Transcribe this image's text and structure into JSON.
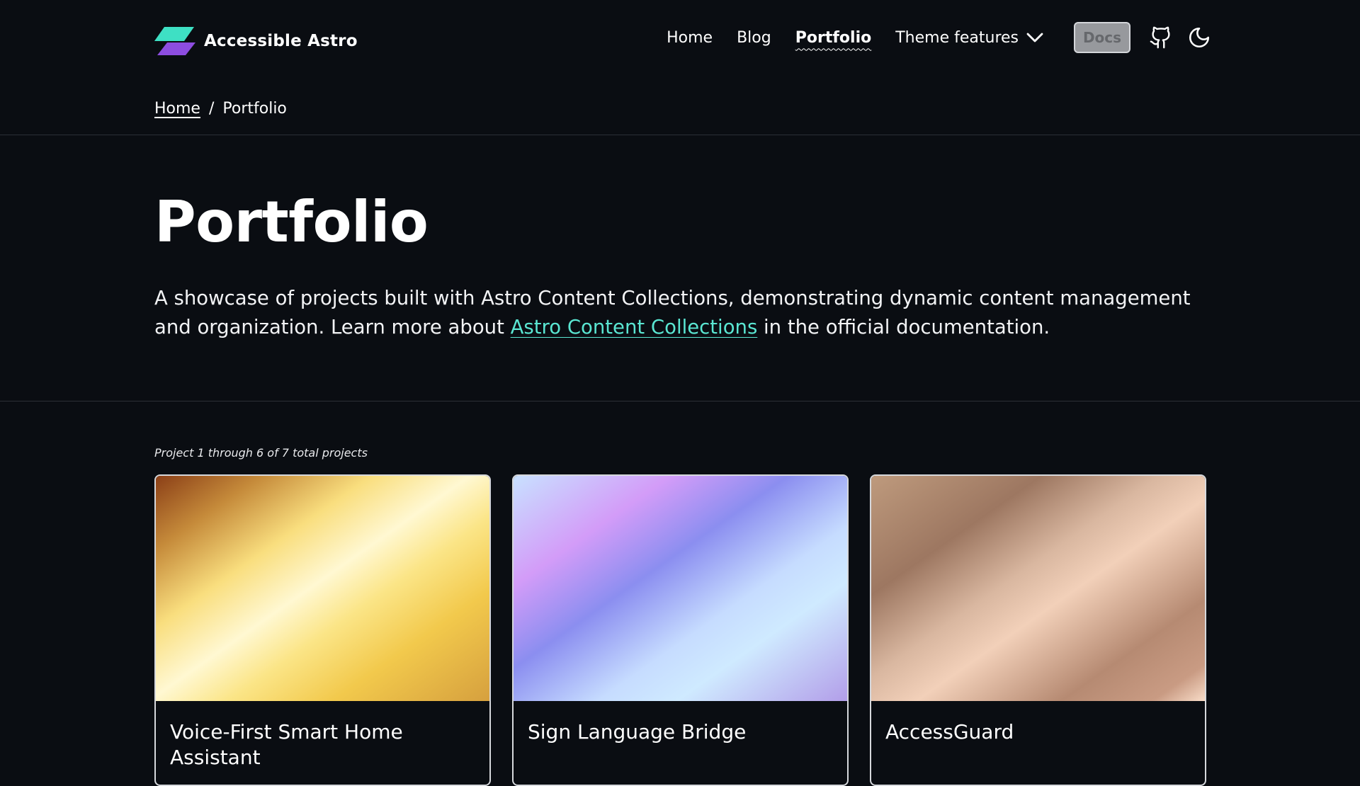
{
  "header": {
    "site_name": "Accessible Astro",
    "nav": [
      {
        "label": "Home"
      },
      {
        "label": "Blog"
      },
      {
        "label": "Portfolio",
        "active": true
      }
    ],
    "dropdown_label": "Theme features",
    "docs_label": "Docs",
    "icons": {
      "logo": "accessible-astro-logo-icon",
      "dropdown": "chevron-down-icon",
      "github": "github-icon",
      "theme_toggle": "moon-icon"
    }
  },
  "breadcrumb": {
    "home": "Home",
    "separator": "/",
    "current": "Portfolio"
  },
  "main": {
    "title": "Portfolio",
    "intro_before": "A showcase of projects built with Astro Content Collections, demonstrating dynamic content management and organization. Learn more about ",
    "intro_link": "Astro Content Collections",
    "intro_after": " in the official documentation."
  },
  "projects": {
    "count_text": "Project 1 through 6 of 7 total projects",
    "items": [
      {
        "title": "Voice-First Smart Home Assistant"
      },
      {
        "title": "Sign Language Bridge"
      },
      {
        "title": "AccessGuard"
      }
    ]
  },
  "colors": {
    "background": "#0a0d12",
    "link": "#5ae6d2",
    "logo_teal": "#3ee0c4",
    "logo_purple": "#8d4de0"
  }
}
